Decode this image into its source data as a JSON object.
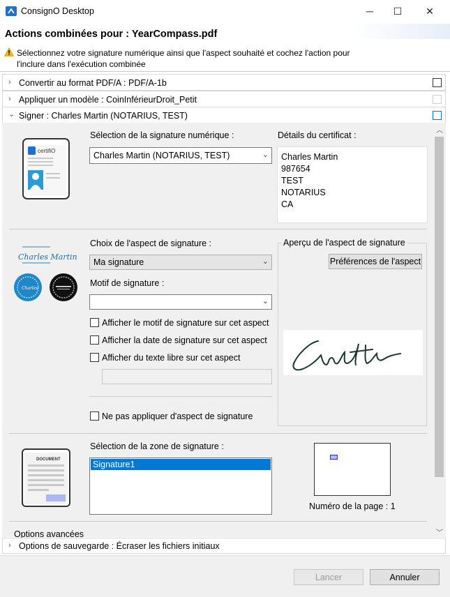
{
  "window": {
    "title": "ConsignO Desktop",
    "minimize_glyph": "─",
    "maximize_glyph": "☐",
    "close_glyph": "✕"
  },
  "header": {
    "title": "Actions combinées pour : YearCompass.pdf",
    "description": "Sélectionnez votre signature numérique ainsi que l'aspect souhaité et cochez l'action pour l'inclure dans l'exécution combinée"
  },
  "actions": [
    {
      "label": "Convertir au format PDF/A : PDF/A-1b",
      "chevron": "›"
    },
    {
      "label": "Appliquer un modèle : CoinInférieurDroit_Petit",
      "chevron": "›"
    },
    {
      "label": "Signer : Charles Martin (NOTARIUS, TEST)",
      "chevron": "⌄"
    }
  ],
  "signature_section": {
    "select_label": "Sélection de la signature numérique :",
    "selected_signature": "Charles Martin (NOTARIUS, TEST)",
    "details_label": "Détails du certificat :",
    "certificate_details": [
      "Charles Martin",
      "987654",
      "TEST",
      "NOTARIUS",
      "CA"
    ],
    "card_brand": "certifiO"
  },
  "aspect_section": {
    "choice_label": "Choix de l'aspect de signature :",
    "selected_aspect": "Ma signature",
    "motif_label": "Motif de signature :",
    "motif_value": "",
    "checkbox_show_motif": "Afficher le motif de signature sur cet aspect",
    "checkbox_show_date": "Afficher la date de signature sur cet aspect",
    "checkbox_free_text": "Afficher du texte libre sur cet aspect",
    "free_text_value": "",
    "checkbox_no_aspect": "Ne pas appliquer d'aspect de signature",
    "preview_group_label": "Aperçu de l'aspect de signature",
    "preferences_button": "Préférences de l'aspect",
    "illustration_signature_text": "Charles Martin"
  },
  "zone_section": {
    "select_label": "Sélection de la zone de signature :",
    "zones": [
      "Signature1"
    ],
    "page_number_label": "Numéro de la page : 1",
    "document_icon_label": "DOCUMENT"
  },
  "advanced_options_label": "Options avancées",
  "save_options": {
    "label": "Options de sauvegarde : Écraser les fichiers initiaux",
    "chevron": "›"
  },
  "footer": {
    "launch_button": "Lancer",
    "cancel_button": "Annuler"
  },
  "colors": {
    "accent_blue": "#0078d7",
    "seal_blue": "#1e88c8"
  }
}
